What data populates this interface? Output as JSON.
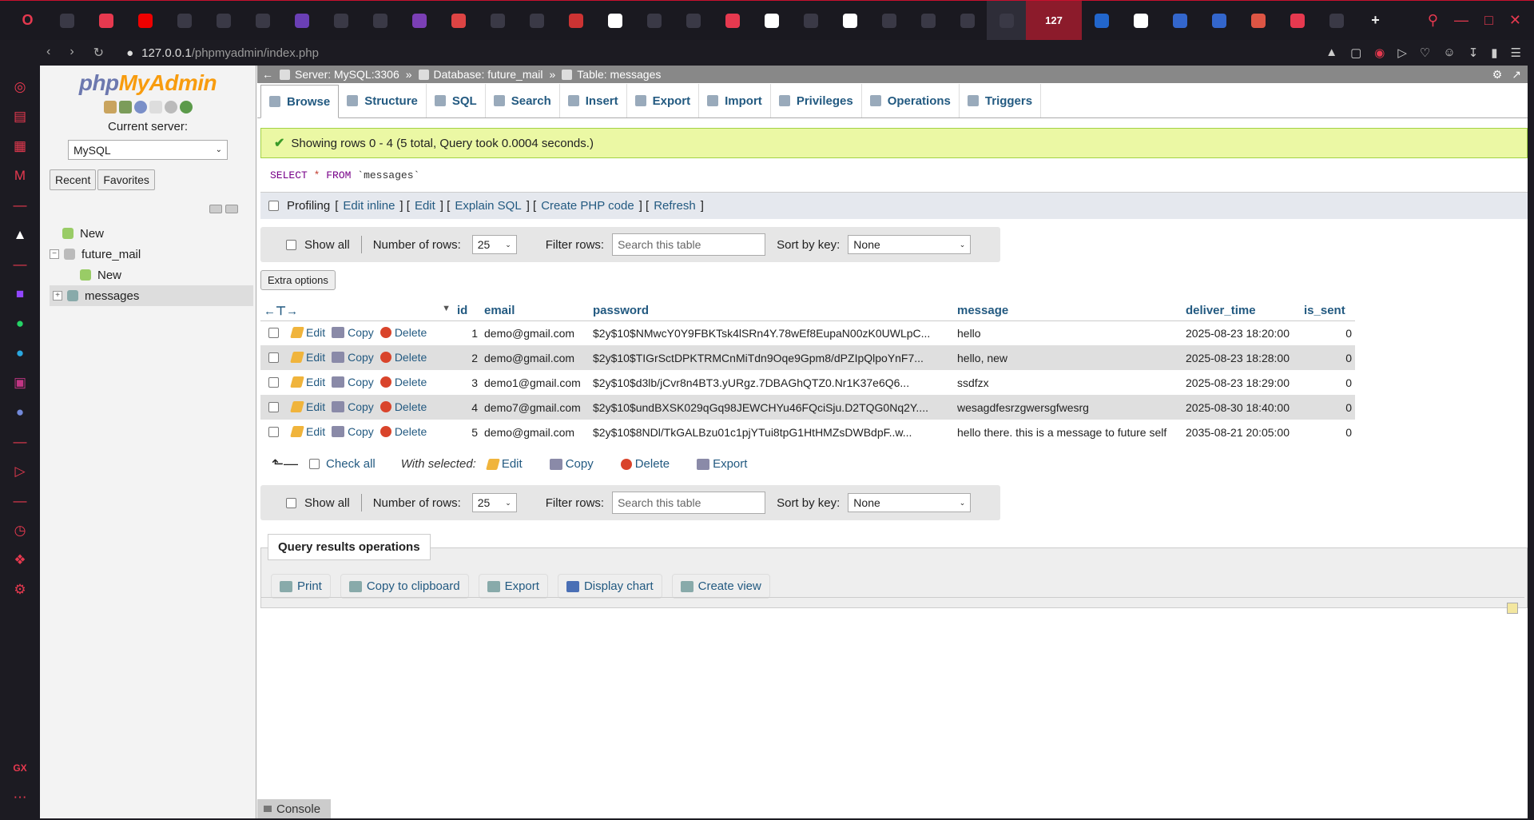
{
  "browser": {
    "tab_count_badge": "127",
    "url_host": "127.0.0.1",
    "url_path": "/phpmyadmin/index.php"
  },
  "pma": {
    "logo_php": "php",
    "logo_my": "MyAdmin",
    "current_server_label": "Current server:",
    "server_value": "MySQL",
    "recent": "Recent",
    "favorites": "Favorites",
    "tree": [
      {
        "label": "New",
        "level": 0
      },
      {
        "label": "future_mail",
        "level": 0
      },
      {
        "label": "New",
        "level": 1
      },
      {
        "label": "messages",
        "level": 1
      }
    ]
  },
  "breadcrumb": {
    "server": "Server: MySQL:3306",
    "database": "Database: future_mail",
    "table": "Table: messages"
  },
  "tabs": [
    "Browse",
    "Structure",
    "SQL",
    "Search",
    "Insert",
    "Export",
    "Import",
    "Privileges",
    "Operations",
    "Triggers"
  ],
  "result": {
    "message": "Showing rows 0 - 4 (5 total, Query took 0.0004 seconds.)",
    "sql_select": "SELECT",
    "sql_star": "*",
    "sql_from": "FROM",
    "sql_table": "`messages`"
  },
  "profiling": {
    "label": "Profiling",
    "links": [
      "Edit inline",
      "Edit",
      "Explain SQL",
      "Create PHP code",
      "Refresh"
    ]
  },
  "nav": {
    "show_all": "Show all",
    "num_rows_label": "Number of rows:",
    "num_rows_value": "25",
    "filter_label": "Filter rows:",
    "filter_placeholder": "Search this table",
    "sort_label": "Sort by key:",
    "sort_value": "None"
  },
  "extra_options": "Extra options",
  "columns": [
    "id",
    "email",
    "password",
    "message",
    "deliver_time",
    "is_sent"
  ],
  "row_actions": {
    "edit": "Edit",
    "copy": "Copy",
    "delete": "Delete"
  },
  "rows": [
    {
      "id": "1",
      "email": "demo@gmail.com",
      "password": "$2y$10$NMwcY0Y9FBKTsk4lSRn4Y.78wEf8EupaN00zK0UWLpC...",
      "message": "hello",
      "deliver_time": "2025-08-23 18:20:00",
      "is_sent": "0"
    },
    {
      "id": "2",
      "email": "demo@gmail.com",
      "password": "$2y$10$TIGrSctDPKTRMCnMiTdn9Oqe9Gpm8/dPZIpQlpoYnF7...",
      "message": "hello, new",
      "deliver_time": "2025-08-23 18:28:00",
      "is_sent": "0"
    },
    {
      "id": "3",
      "email": "demo1@gmail.com",
      "password": "$2y$10$d3lb/jCvr8n4BT3.yURgz.7DBAGhQTZ0.Nr1K37e6Q6...",
      "message": "ssdfzx",
      "deliver_time": "2025-08-23 18:29:00",
      "is_sent": "0"
    },
    {
      "id": "4",
      "email": "demo7@gmail.com",
      "password": "$2y$10$undBXSK029qGq98JEWCHYu46FQciSju.D2TQG0Nq2Y....",
      "message": "wesagdfesrzgwersgfwesrg",
      "deliver_time": "2025-08-30 18:40:00",
      "is_sent": "0"
    },
    {
      "id": "5",
      "email": "demo@gmail.com",
      "password": "$2y$10$8NDl/TkGALBzu01c1pjYTui8tpG1HtHMZsDWBdpF..w...",
      "message": "hello there. this is a message to future self",
      "deliver_time": "2035-08-21 20:05:00",
      "is_sent": "0"
    }
  ],
  "with_selected": {
    "check_all": "Check all",
    "label": "With selected:",
    "edit": "Edit",
    "copy": "Copy",
    "delete": "Delete",
    "export": "Export"
  },
  "ops": {
    "legend": "Query results operations",
    "buttons": [
      "Print",
      "Copy to clipboard",
      "Export",
      "Display chart",
      "Create view"
    ]
  },
  "console": "Console"
}
